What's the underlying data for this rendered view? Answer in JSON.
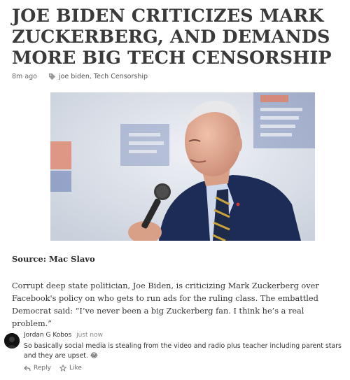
{
  "article": {
    "title": "JOE BIDEN CRITICIZES MARK ZUCKERBERG, AND DEMANDS MORE BIG TECH CENSORSHIP",
    "time_ago": "8m ago",
    "tags": [
      "joe biden",
      "Tech Censorship"
    ],
    "tag_separator": ",",
    "source": "Source: Mac Slavo",
    "body": "Corrupt deep state politician, Joe Biden, is criticizing Mark Zuckerberg over Facebook's policy on who gets to run ads for the ruling class.  The embattled Democrat said: “I’ve never been a big Zuckerberg fan. I think he’s a real problem.”"
  },
  "comment": {
    "author": "Jordan G Kobos",
    "time": "just now",
    "text": "So basically social media is stealing from the video and radio plus teacher including parent stars and they are upset. 😂",
    "reply_label": "Reply",
    "like_label": "Like"
  },
  "icons": {
    "tag": "tag-icon",
    "reply": "reply-icon",
    "like": "star-icon"
  },
  "colors": {
    "title": "#3a3a3a",
    "suit": "#1c2c57",
    "backdrop": "#dfe3ea"
  }
}
